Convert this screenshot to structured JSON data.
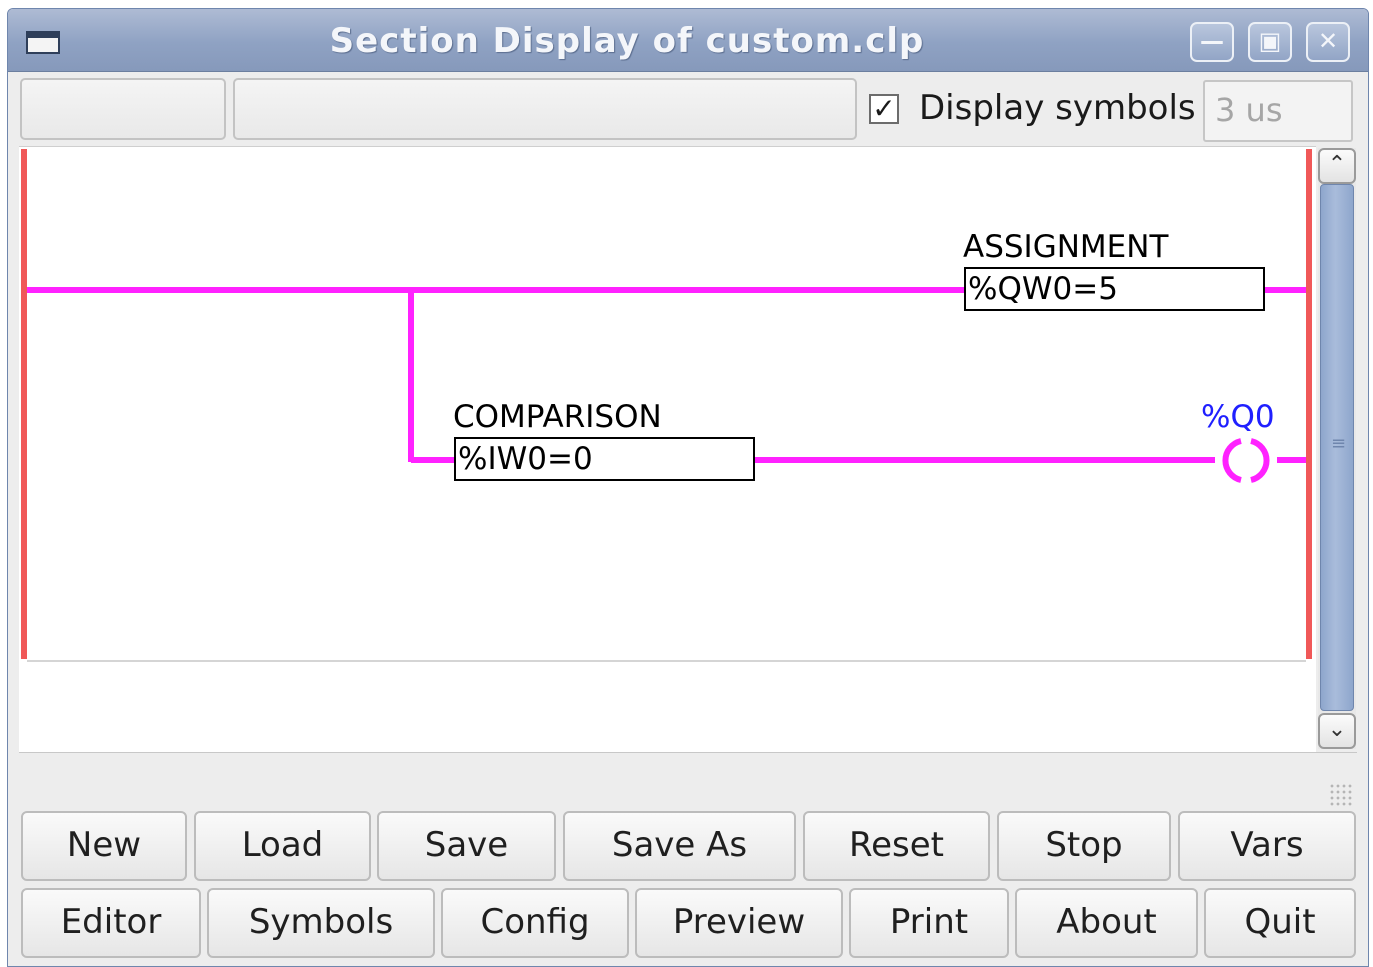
{
  "window": {
    "title": "Section Display of custom.clp"
  },
  "toolbar": {
    "display_symbols_label": "Display symbols",
    "display_symbols_checked": true,
    "scan_time": "3 us"
  },
  "ladder": {
    "rung1": {
      "block_label": "ASSIGNMENT",
      "block_value": "%QW0=5"
    },
    "rung2": {
      "block_label": "COMPARISON",
      "block_value": "%IW0=0",
      "coil_label": "%Q0"
    },
    "colors": {
      "rail": "#f05858",
      "wire": "#ff22ff",
      "coil_label": "#2020ff"
    }
  },
  "buttons": {
    "row1": [
      "New",
      "Load",
      "Save",
      "Save As",
      "Reset",
      "Stop",
      "Vars"
    ],
    "row2": [
      "Editor",
      "Symbols",
      "Config",
      "Preview",
      "Print",
      "About",
      "Quit"
    ]
  }
}
